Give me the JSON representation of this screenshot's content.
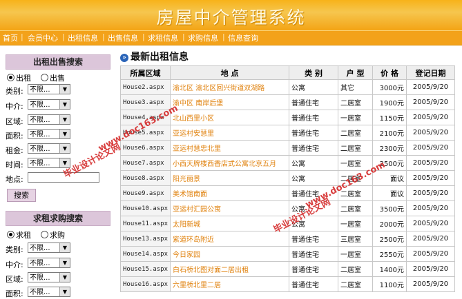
{
  "site": {
    "title": "房屋中介管理系统"
  },
  "nav": [
    "首页",
    "会员中心",
    "出租信息",
    "出售信息",
    "求租信息",
    "求购信息",
    "信息查询"
  ],
  "rent_sale_search": {
    "heading": "出租出售搜索",
    "radio_rent": "出租",
    "radio_sale": "出售",
    "selected": "出租",
    "fields": [
      {
        "label": "类别:",
        "value": "不限..."
      },
      {
        "label": "中介:",
        "value": "不限..."
      },
      {
        "label": "区域:",
        "value": "不限..."
      },
      {
        "label": "面积:",
        "value": "不限..."
      },
      {
        "label": "租金:",
        "value": "不限..."
      },
      {
        "label": "时间:",
        "value": "不限..."
      }
    ],
    "location_label": "地点:",
    "search_button": "搜索"
  },
  "want_search": {
    "heading": "求租求购搜索",
    "radio_rent": "求租",
    "radio_buy": "求购",
    "selected": "求租",
    "fields": [
      {
        "label": "类别:",
        "value": "不限..."
      },
      {
        "label": "中介:",
        "value": "不限..."
      },
      {
        "label": "区域:",
        "value": "不限..."
      },
      {
        "label": "面积:",
        "value": "不限..."
      }
    ]
  },
  "listing": {
    "title": "最新出租信息",
    "columns": [
      "所属区域",
      "地  点",
      "类  别",
      "户  型",
      "价  格",
      "登记日期"
    ],
    "rows": [
      [
        "House2.aspx",
        "渝北区 渝北区回兴街道双湖路",
        "公寓",
        "其它",
        "3000元",
        "2005/9/20"
      ],
      [
        "House3.aspx",
        "渝中区 南岸后堡",
        "普通住宅",
        "二居室",
        "1900元",
        "2005/9/20"
      ],
      [
        "House4.aspx",
        "北山西里小区",
        "普通住宅",
        "一居室",
        "1150元",
        "2005/9/20"
      ],
      [
        "House5.aspx",
        "亚运村安慧里",
        "普通住宅",
        "二居室",
        "2100元",
        "2005/9/20"
      ],
      [
        "House6.aspx",
        "亚运村慧忠北里",
        "普通住宅",
        "二居室",
        "2300元",
        "2005/9/20"
      ],
      [
        "House7.aspx",
        "小西天牌楼西香店式公寓北京五月",
        "公寓",
        "一居室",
        "2500元",
        "2005/9/20"
      ],
      [
        "House8.aspx",
        "阳光丽景",
        "公寓",
        "二居室",
        "面议",
        "2005/9/20"
      ],
      [
        "House9.aspx",
        "美术馆南面",
        "普通住宅",
        "二居室",
        "面议",
        "2005/9/20"
      ],
      [
        "House10.aspx",
        "亚运村汇园公寓",
        "公寓",
        "二居室",
        "3500元",
        "2005/9/20"
      ],
      [
        "House11.aspx",
        "太阳新城",
        "公寓",
        "一居室",
        "2000元",
        "2005/9/20"
      ],
      [
        "House13.aspx",
        "紫道环岛附近",
        "普通住宅",
        "三居室",
        "2500元",
        "2005/9/20"
      ],
      [
        "House14.aspx",
        "今日家园",
        "普通住宅",
        "一居室",
        "2550元",
        "2005/9/20"
      ],
      [
        "House15.aspx",
        "白石桥北图对面二居出租",
        "普通住宅",
        "二居室",
        "1400元",
        "2005/9/20"
      ],
      [
        "House16.aspx",
        "六里桥北里二居",
        "普通住宅",
        "二居室",
        "1100元",
        "2005/9/20"
      ]
    ]
  },
  "watermarks": {
    "url": "www.doc163.com",
    "text": "毕业设计论文网"
  }
}
